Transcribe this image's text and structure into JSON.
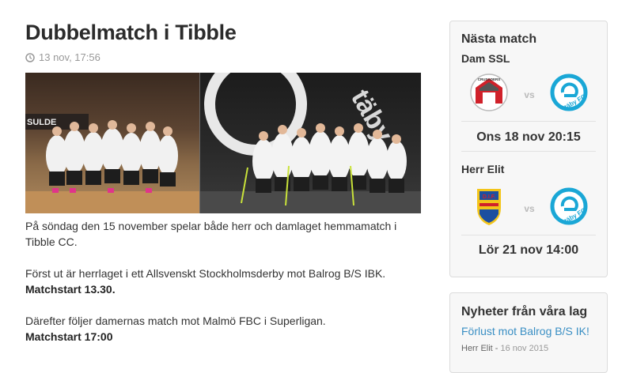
{
  "article": {
    "title": "Dubbelmatch i Tibble",
    "date": "13 nov, 17:56",
    "paragraphs": [
      "På söndag den 15 november spelar både herr och damlaget hemmamatch i Tibble CC.",
      "Först ut är herrlaget i ett Allsvenskt Stockholmsderby mot Balrog B/S IBK.",
      "Därefter följer damernas match mot Malmö FBC i Superligan."
    ],
    "match1_start": "Matchstart 13.30.",
    "match2_start": "Matchstart 17:00"
  },
  "sidebar": {
    "next_match": {
      "heading": "Nästa match",
      "vs_label": "vs",
      "matches": [
        {
          "league": "Dam SSL",
          "home_logo": "crusaders-logo",
          "home_logo_text": "CRUSADERS",
          "away_logo": "taby-fc-logo",
          "away_logo_text": "täby FC",
          "datetime": "Ons 18 nov 20:15"
        },
        {
          "league": "Herr Elit",
          "home_logo": "djurgarden-logo",
          "home_logo_text": "D.I.F.",
          "away_logo": "taby-fc-logo",
          "away_logo_text": "täby FC",
          "datetime": "Lör 21 nov 14:00"
        }
      ]
    },
    "news": {
      "heading": "Nyheter från våra lag",
      "items": [
        {
          "title": "Förlust mot Balrog B/S IK!",
          "category": "Herr Elit",
          "date": "16 nov 2015"
        }
      ]
    }
  },
  "colors": {
    "link": "#3a8fc4",
    "taby_blue": "#1aa7d6",
    "crusaders_red": "#d0212a",
    "dif_blue": "#1c4fa0",
    "dif_yellow": "#f3c51a"
  }
}
